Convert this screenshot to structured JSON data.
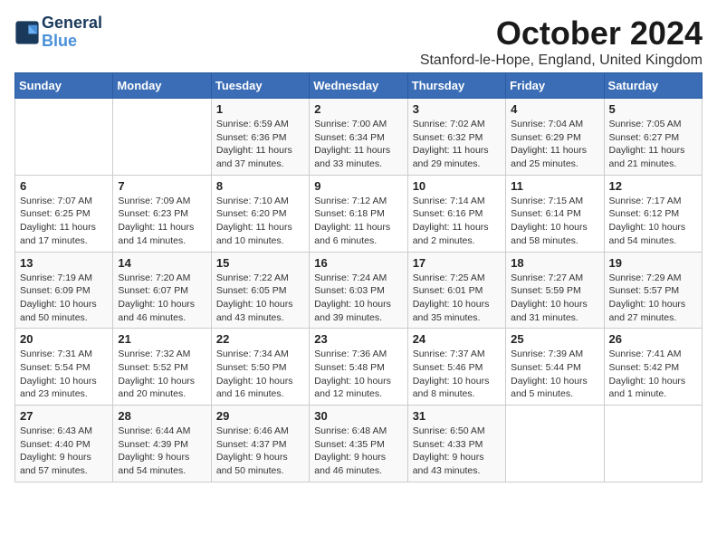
{
  "header": {
    "logo_line1": "General",
    "logo_line2": "Blue",
    "month_title": "October 2024",
    "location": "Stanford-le-Hope, England, United Kingdom"
  },
  "days_of_week": [
    "Sunday",
    "Monday",
    "Tuesday",
    "Wednesday",
    "Thursday",
    "Friday",
    "Saturday"
  ],
  "weeks": [
    [
      {
        "day": "",
        "info": ""
      },
      {
        "day": "",
        "info": ""
      },
      {
        "day": "1",
        "info": "Sunrise: 6:59 AM\nSunset: 6:36 PM\nDaylight: 11 hours and 37 minutes."
      },
      {
        "day": "2",
        "info": "Sunrise: 7:00 AM\nSunset: 6:34 PM\nDaylight: 11 hours and 33 minutes."
      },
      {
        "day": "3",
        "info": "Sunrise: 7:02 AM\nSunset: 6:32 PM\nDaylight: 11 hours and 29 minutes."
      },
      {
        "day": "4",
        "info": "Sunrise: 7:04 AM\nSunset: 6:29 PM\nDaylight: 11 hours and 25 minutes."
      },
      {
        "day": "5",
        "info": "Sunrise: 7:05 AM\nSunset: 6:27 PM\nDaylight: 11 hours and 21 minutes."
      }
    ],
    [
      {
        "day": "6",
        "info": "Sunrise: 7:07 AM\nSunset: 6:25 PM\nDaylight: 11 hours and 17 minutes."
      },
      {
        "day": "7",
        "info": "Sunrise: 7:09 AM\nSunset: 6:23 PM\nDaylight: 11 hours and 14 minutes."
      },
      {
        "day": "8",
        "info": "Sunrise: 7:10 AM\nSunset: 6:20 PM\nDaylight: 11 hours and 10 minutes."
      },
      {
        "day": "9",
        "info": "Sunrise: 7:12 AM\nSunset: 6:18 PM\nDaylight: 11 hours and 6 minutes."
      },
      {
        "day": "10",
        "info": "Sunrise: 7:14 AM\nSunset: 6:16 PM\nDaylight: 11 hours and 2 minutes."
      },
      {
        "day": "11",
        "info": "Sunrise: 7:15 AM\nSunset: 6:14 PM\nDaylight: 10 hours and 58 minutes."
      },
      {
        "day": "12",
        "info": "Sunrise: 7:17 AM\nSunset: 6:12 PM\nDaylight: 10 hours and 54 minutes."
      }
    ],
    [
      {
        "day": "13",
        "info": "Sunrise: 7:19 AM\nSunset: 6:09 PM\nDaylight: 10 hours and 50 minutes."
      },
      {
        "day": "14",
        "info": "Sunrise: 7:20 AM\nSunset: 6:07 PM\nDaylight: 10 hours and 46 minutes."
      },
      {
        "day": "15",
        "info": "Sunrise: 7:22 AM\nSunset: 6:05 PM\nDaylight: 10 hours and 43 minutes."
      },
      {
        "day": "16",
        "info": "Sunrise: 7:24 AM\nSunset: 6:03 PM\nDaylight: 10 hours and 39 minutes."
      },
      {
        "day": "17",
        "info": "Sunrise: 7:25 AM\nSunset: 6:01 PM\nDaylight: 10 hours and 35 minutes."
      },
      {
        "day": "18",
        "info": "Sunrise: 7:27 AM\nSunset: 5:59 PM\nDaylight: 10 hours and 31 minutes."
      },
      {
        "day": "19",
        "info": "Sunrise: 7:29 AM\nSunset: 5:57 PM\nDaylight: 10 hours and 27 minutes."
      }
    ],
    [
      {
        "day": "20",
        "info": "Sunrise: 7:31 AM\nSunset: 5:54 PM\nDaylight: 10 hours and 23 minutes."
      },
      {
        "day": "21",
        "info": "Sunrise: 7:32 AM\nSunset: 5:52 PM\nDaylight: 10 hours and 20 minutes."
      },
      {
        "day": "22",
        "info": "Sunrise: 7:34 AM\nSunset: 5:50 PM\nDaylight: 10 hours and 16 minutes."
      },
      {
        "day": "23",
        "info": "Sunrise: 7:36 AM\nSunset: 5:48 PM\nDaylight: 10 hours and 12 minutes."
      },
      {
        "day": "24",
        "info": "Sunrise: 7:37 AM\nSunset: 5:46 PM\nDaylight: 10 hours and 8 minutes."
      },
      {
        "day": "25",
        "info": "Sunrise: 7:39 AM\nSunset: 5:44 PM\nDaylight: 10 hours and 5 minutes."
      },
      {
        "day": "26",
        "info": "Sunrise: 7:41 AM\nSunset: 5:42 PM\nDaylight: 10 hours and 1 minute."
      }
    ],
    [
      {
        "day": "27",
        "info": "Sunrise: 6:43 AM\nSunset: 4:40 PM\nDaylight: 9 hours and 57 minutes."
      },
      {
        "day": "28",
        "info": "Sunrise: 6:44 AM\nSunset: 4:39 PM\nDaylight: 9 hours and 54 minutes."
      },
      {
        "day": "29",
        "info": "Sunrise: 6:46 AM\nSunset: 4:37 PM\nDaylight: 9 hours and 50 minutes."
      },
      {
        "day": "30",
        "info": "Sunrise: 6:48 AM\nSunset: 4:35 PM\nDaylight: 9 hours and 46 minutes."
      },
      {
        "day": "31",
        "info": "Sunrise: 6:50 AM\nSunset: 4:33 PM\nDaylight: 9 hours and 43 minutes."
      },
      {
        "day": "",
        "info": ""
      },
      {
        "day": "",
        "info": ""
      }
    ]
  ]
}
